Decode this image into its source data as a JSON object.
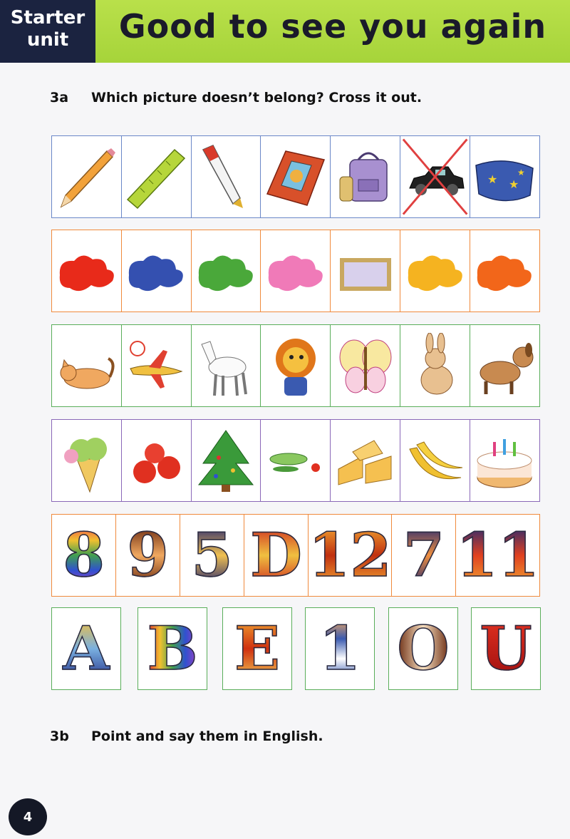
{
  "header": {
    "unit_line1": "Starter",
    "unit_line2": "unit",
    "title": "Good to see you again",
    "accent": "#a6d43a",
    "unit_bg": "#1b2340"
  },
  "exercise_a": {
    "number": "3a",
    "instruction": "Which picture doesn’t belong? Cross it out.",
    "rows": [
      {
        "items": [
          "pencil-icon",
          "ruler-icon",
          "pen-icon",
          "book-icon",
          "schoolbag-icon",
          "car-icon",
          "pencil-case-icon"
        ],
        "crossed_index": 5
      },
      {
        "items": [
          "red-paint-icon",
          "blue-paint-icon",
          "green-paint-icon",
          "pink-paint-icon",
          "picture-frame-icon",
          "yellow-paint-icon",
          "orange-paint-icon"
        ]
      },
      {
        "items": [
          "cat-icon",
          "plane-icon",
          "horse-icon",
          "lion-icon",
          "butterfly-icon",
          "rabbit-icon",
          "dog-icon"
        ]
      },
      {
        "items": [
          "ice-cream-icon",
          "apples-icon",
          "christmas-tree-icon",
          "vegetables-icon",
          "cheese-icon",
          "bananas-icon",
          "birthday-cake-icon"
        ]
      },
      {
        "symbols": [
          "8",
          "9",
          "5",
          "D",
          "12",
          "7",
          "11"
        ]
      },
      {
        "symbols": [
          "A",
          "B",
          "E",
          "1",
          "O",
          "U"
        ]
      }
    ]
  },
  "exercise_b": {
    "number": "3b",
    "instruction": "Point and say them in English."
  },
  "page_number": "4"
}
